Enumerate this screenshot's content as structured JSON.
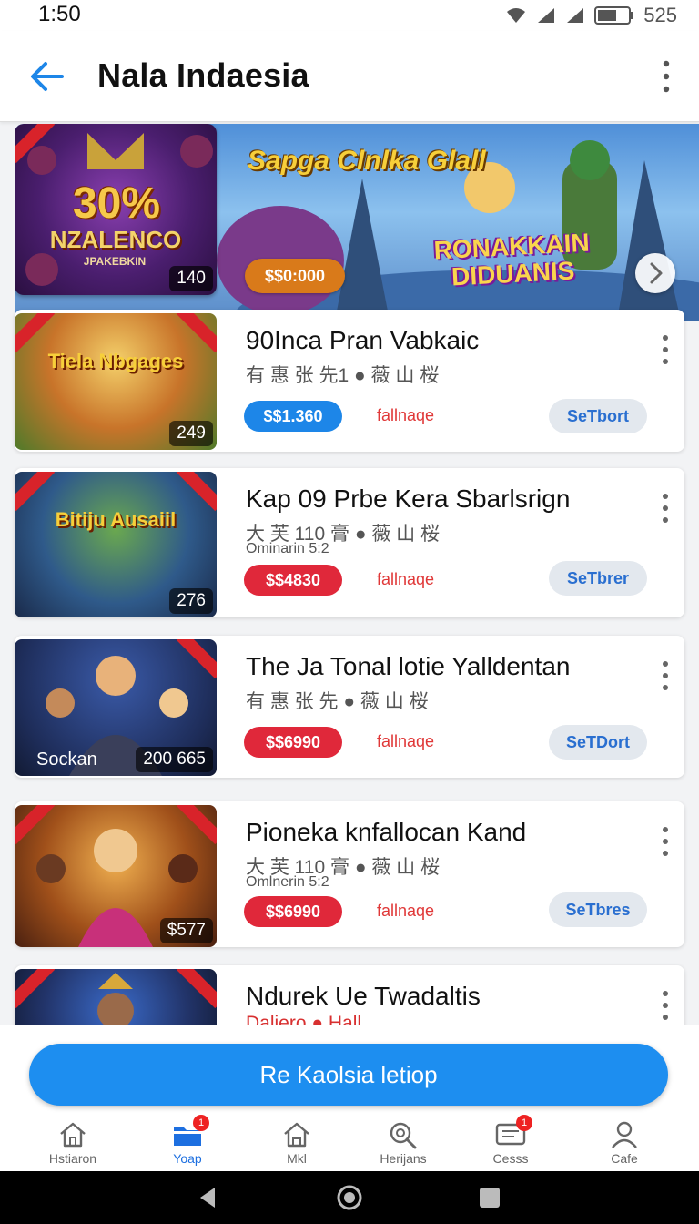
{
  "status_bar": {
    "time": "1:50",
    "battery": "525"
  },
  "app_bar": {
    "title": "Nala Indaesia"
  },
  "hero": {
    "promo_big": "30%",
    "promo_name": "NZALENCO",
    "promo_sub": "JPAKEBKIN",
    "badge": "140",
    "title": "Sapga Clnlka Glall",
    "subtitle": "RONAKKAIN DIDUANIS",
    "price": "$$0:000"
  },
  "cards": [
    {
      "thumb_title": "Tiela Nbgages",
      "badge": "249",
      "title": "90Inca Pran Vabkaic",
      "meta": "有 惠 张 先1 ● 薇 山 桜",
      "sub": "",
      "price": "$$1.360",
      "price_color": "#1d86e8",
      "status": "fallnaqe",
      "action": "SeTbort"
    },
    {
      "thumb_title": "Bitiju Ausaiil",
      "badge": "276",
      "title": "Kap 09 Prbe Kera Sbarlsrign",
      "meta": "大 芙 110 膏 ● 薇 山 桜",
      "sub": "Ominarin 5:2",
      "price": "$$4830",
      "price_color": "#e0283a",
      "status": "fallnaqe",
      "action": "SeTbrer"
    },
    {
      "thumb_title": "",
      "badge": "200 665",
      "badge_left": "Sockan",
      "title": "The Ja Tonal lotie Yalldentan",
      "meta": "有 惠 张 先 ● 薇 山 桜",
      "sub": "",
      "price": "$$6990",
      "price_color": "#e0283a",
      "status": "fallnaqe",
      "action": "SeTDort"
    },
    {
      "thumb_title": "",
      "badge": "$577",
      "title": "Pioneka knfallocan Kand",
      "meta": "大 芙 110 膏 ● 薇 山 桜",
      "sub": "Omlnerin 5:2",
      "price": "$$6990",
      "price_color": "#e0283a",
      "status": "fallnaqe",
      "action": "SeTbres"
    },
    {
      "thumb_title": "",
      "badge": "",
      "title": "Ndurek Ue Twadaltis",
      "meta": "Daliero ● Hall",
      "sub": "",
      "price": "",
      "price_color": "#e0283a",
      "status": "",
      "action": ""
    }
  ],
  "cta": {
    "label": "Re Kaolsia letiop"
  },
  "bottom_nav": [
    {
      "label": "Hstiaron",
      "icon": "home-icon",
      "badge": ""
    },
    {
      "label": "Yoap",
      "icon": "folder-icon",
      "badge": "1"
    },
    {
      "label": "Mkl",
      "icon": "home-outline-icon",
      "badge": ""
    },
    {
      "label": "Herijans",
      "icon": "search-gear-icon",
      "badge": ""
    },
    {
      "label": "Cesss",
      "icon": "message-icon",
      "badge": "1"
    },
    {
      "label": "Cafe",
      "icon": "person-icon",
      "badge": ""
    }
  ],
  "colors": {
    "accent": "#1d8ef0",
    "active_nav": "#1d6fe0",
    "danger": "#e0283a"
  }
}
